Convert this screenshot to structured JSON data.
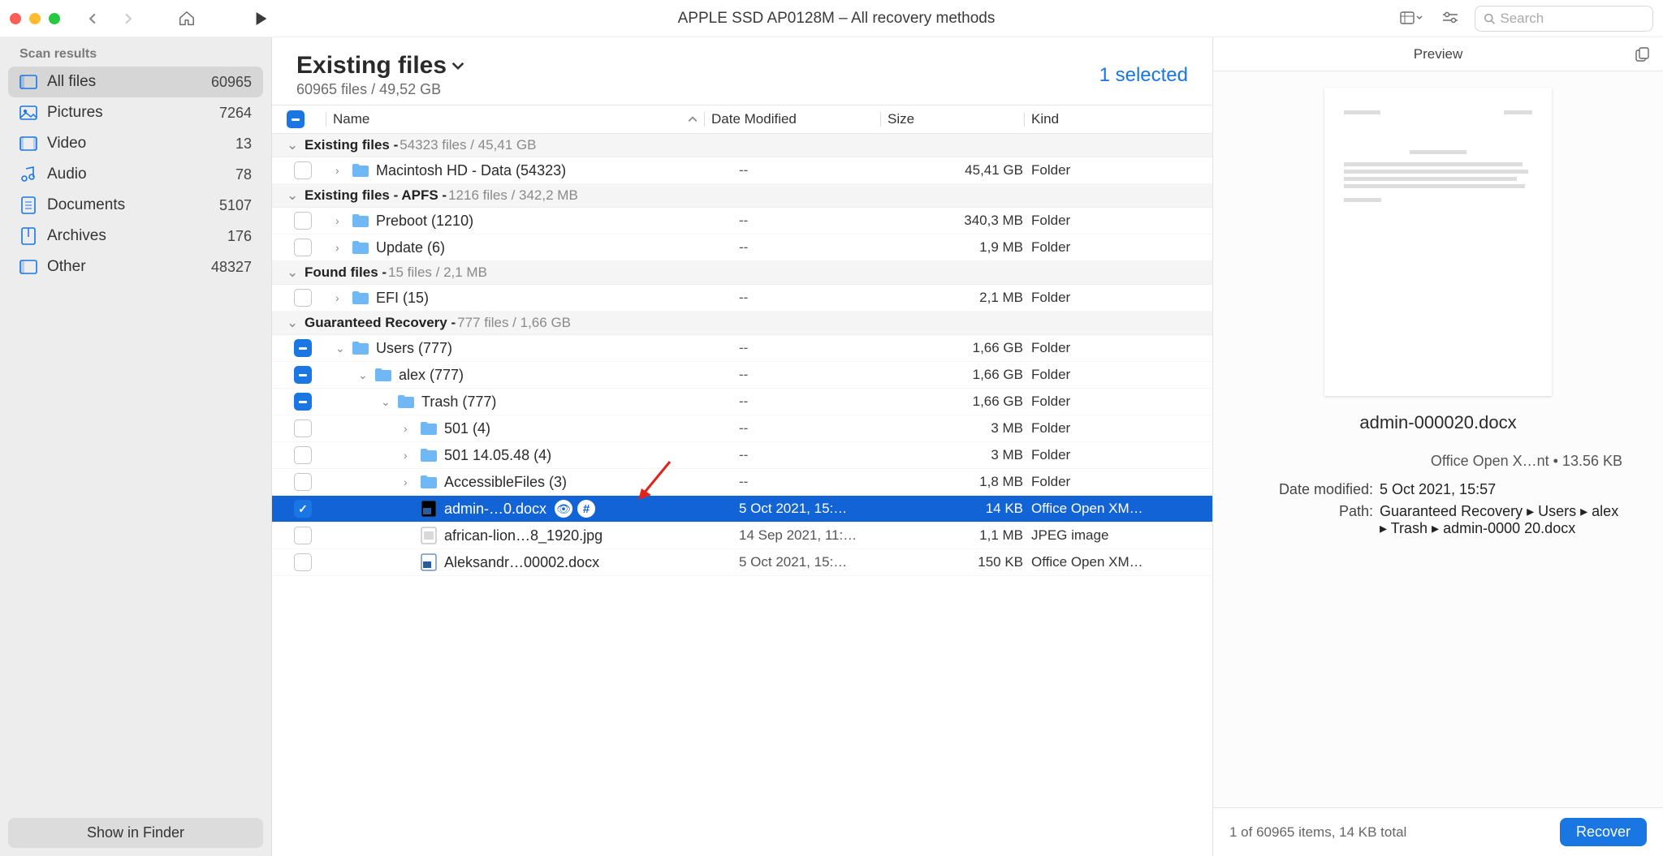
{
  "window": {
    "title": "APPLE SSD AP0128M – All recovery methods",
    "search_placeholder": "Search"
  },
  "sidebar": {
    "header": "Scan results",
    "items": [
      {
        "label": "All files",
        "count": "60965",
        "icon": "all"
      },
      {
        "label": "Pictures",
        "count": "7264",
        "icon": "pic"
      },
      {
        "label": "Video",
        "count": "13",
        "icon": "vid"
      },
      {
        "label": "Audio",
        "count": "78",
        "icon": "aud"
      },
      {
        "label": "Documents",
        "count": "5107",
        "icon": "doc"
      },
      {
        "label": "Archives",
        "count": "176",
        "icon": "arc"
      },
      {
        "label": "Other",
        "count": "48327",
        "icon": "oth"
      }
    ],
    "footer": "Show in Finder"
  },
  "main": {
    "heading": "Existing files",
    "subheading": "60965 files / 49,52 GB",
    "selected_text": "1 selected",
    "columns": {
      "name": "Name",
      "date": "Date Modified",
      "size": "Size",
      "kind": "Kind"
    }
  },
  "groups": [
    {
      "label": "Existing files - ",
      "stats": "54323 files / 45,41 GB"
    },
    {
      "label": "Existing files - APFS - ",
      "stats": "1216 files / 342,2 MB"
    },
    {
      "label": "Found files - ",
      "stats": "15 files / 2,1 MB"
    },
    {
      "label": "Guaranteed Recovery - ",
      "stats": "777 files / 1,66 GB"
    }
  ],
  "rows": {
    "mac": {
      "name": "Macintosh HD - Data (54323)",
      "date": "--",
      "size": "45,41 GB",
      "kind": "Folder"
    },
    "preboot": {
      "name": "Preboot (1210)",
      "date": "--",
      "size": "340,3 MB",
      "kind": "Folder"
    },
    "update": {
      "name": "Update (6)",
      "date": "--",
      "size": "1,9 MB",
      "kind": "Folder"
    },
    "efi": {
      "name": "EFI (15)",
      "date": "--",
      "size": "2,1 MB",
      "kind": "Folder"
    },
    "users": {
      "name": "Users (777)",
      "date": "--",
      "size": "1,66 GB",
      "kind": "Folder"
    },
    "alex": {
      "name": "alex (777)",
      "date": "--",
      "size": "1,66 GB",
      "kind": "Folder"
    },
    "trash": {
      "name": "Trash (777)",
      "date": "--",
      "size": "1,66 GB",
      "kind": "Folder"
    },
    "f501": {
      "name": "501 (4)",
      "date": "--",
      "size": "3 MB",
      "kind": "Folder"
    },
    "f501b": {
      "name": "501 14.05.48 (4)",
      "date": "--",
      "size": "3 MB",
      "kind": "Folder"
    },
    "access": {
      "name": "AccessibleFiles (3)",
      "date": "--",
      "size": "1,8 MB",
      "kind": "Folder"
    },
    "admin": {
      "name": "admin-…0.docx",
      "date": "5 Oct 2021, 15:…",
      "size": "14 KB",
      "kind": "Office Open XM…"
    },
    "lion": {
      "name": "african-lion…8_1920.jpg",
      "date": "14 Sep 2021, 11:…",
      "size": "1,1 MB",
      "kind": "JPEG image"
    },
    "aleks": {
      "name": "Aleksandr…00002.docx",
      "date": "5 Oct 2021, 15:…",
      "size": "150 KB",
      "kind": "Office Open XM…"
    }
  },
  "preview": {
    "header": "Preview",
    "filename": "admin-000020.docx",
    "info_line": "Office Open X…nt • 13.56 KB",
    "date_label": "Date modified:",
    "date_value": "5 Oct 2021, 15:57",
    "path_label": "Path:",
    "path_value": "Guaranteed Recovery ▸ Users ▸ alex ▸ Trash ▸ admin-0000 20.docx",
    "status": "1 of 60965 items, 14 KB total",
    "button": "Recover"
  }
}
